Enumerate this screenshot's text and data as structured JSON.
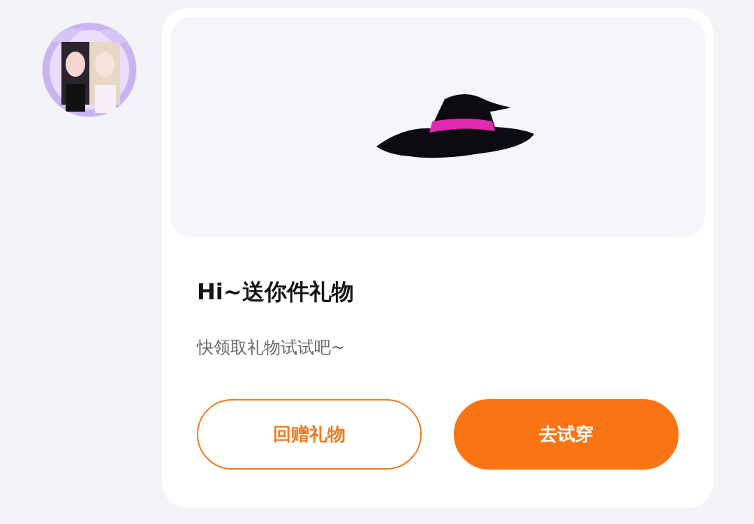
{
  "gift_card": {
    "title": "Hi~送你件礼物",
    "subtitle": "快领取礼物试试吧~",
    "buttons": [
      {
        "label": "回赠礼物",
        "kind": "outline"
      },
      {
        "label": "去试穿",
        "kind": "filled"
      }
    ]
  }
}
